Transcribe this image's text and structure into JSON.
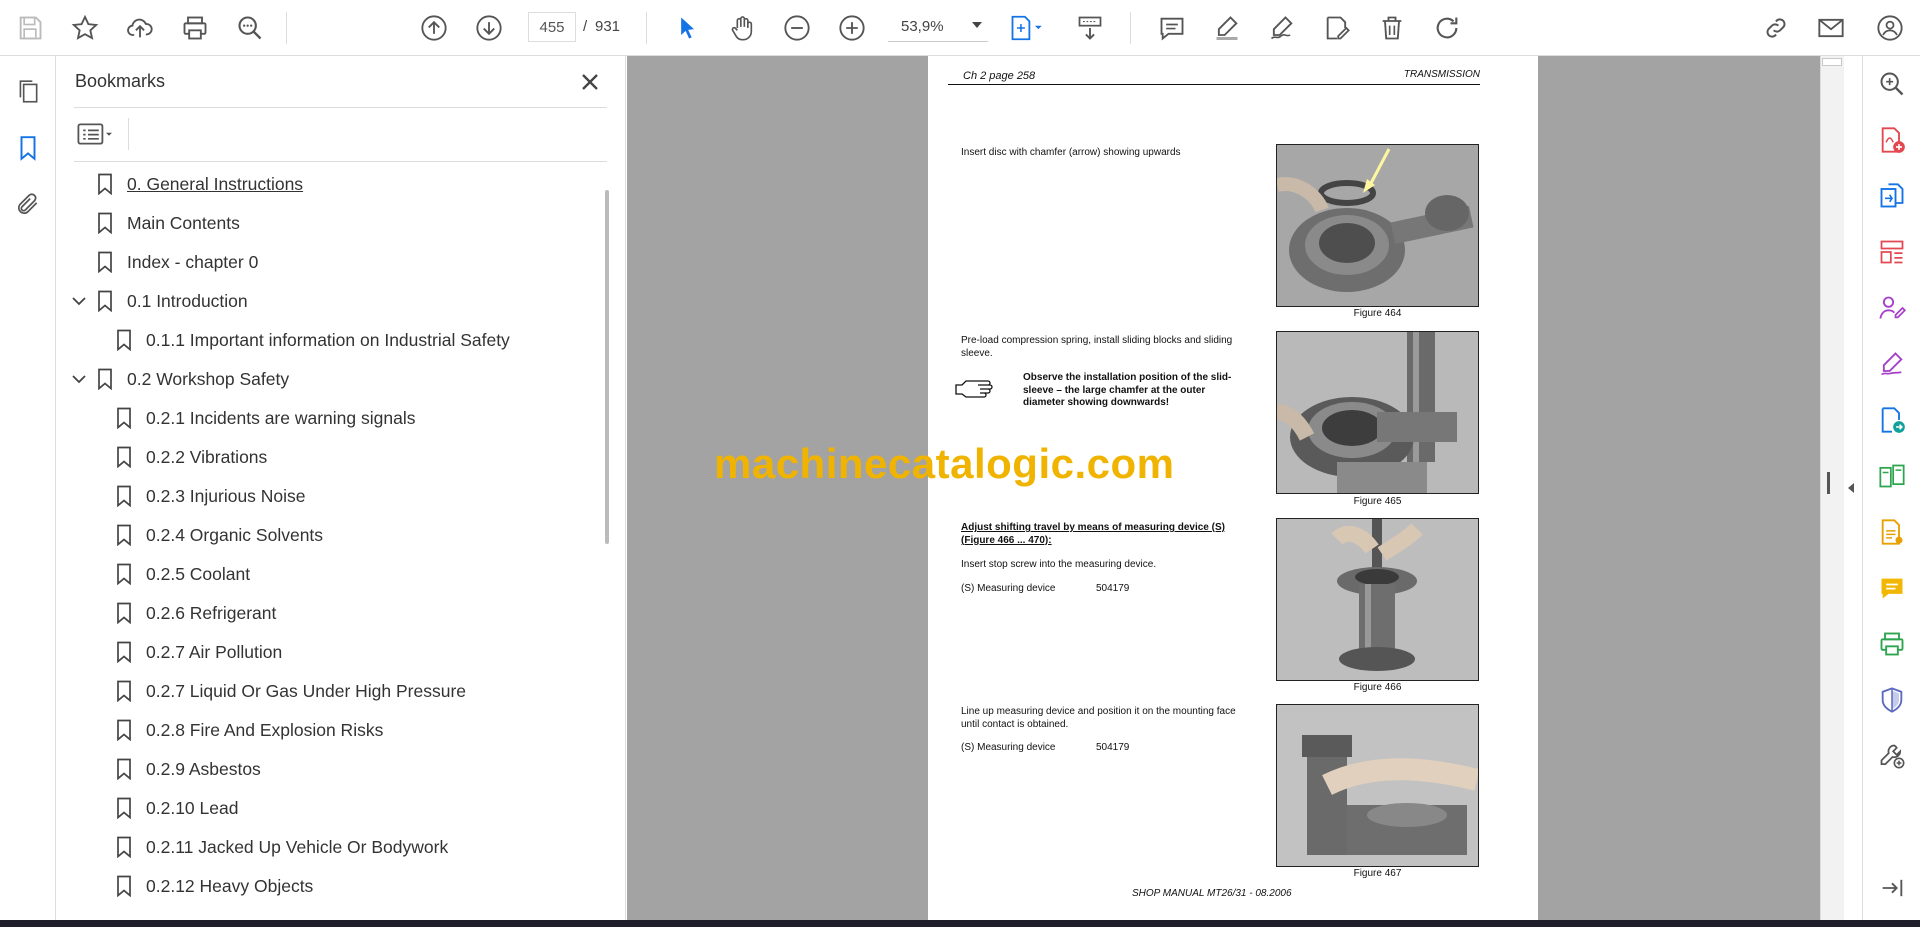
{
  "toolbar": {
    "page_current": "455",
    "page_separator": "/",
    "page_total": "931",
    "zoom": "53,9%"
  },
  "bookmarks_panel": {
    "title": "Bookmarks",
    "items": [
      {
        "label": "0. General Instructions",
        "level": 0,
        "expandable": false
      },
      {
        "label": "Main Contents",
        "level": 0,
        "expandable": false
      },
      {
        "label": "Index - chapter 0",
        "level": 0,
        "expandable": false
      },
      {
        "label": "0.1 Introduction",
        "level": 0,
        "expandable": true
      },
      {
        "label": "0.1.1 Important information on Industrial Safety",
        "level": 1,
        "expandable": false
      },
      {
        "label": "0.2 Workshop Safety",
        "level": 0,
        "expandable": true
      },
      {
        "label": "0.2.1 Incidents are warning signals",
        "level": 1,
        "expandable": false
      },
      {
        "label": "0.2.2  Vibrations",
        "level": 1,
        "expandable": false
      },
      {
        "label": "0.2.3 Injurious Noise",
        "level": 1,
        "expandable": false
      },
      {
        "label": "0.2.4 Organic Solvents",
        "level": 1,
        "expandable": false
      },
      {
        "label": "0.2.5 Coolant",
        "level": 1,
        "expandable": false
      },
      {
        "label": "0.2.6 Refrigerant",
        "level": 1,
        "expandable": false
      },
      {
        "label": "0.2.7 Air Pollution",
        "level": 1,
        "expandable": false
      },
      {
        "label": "0.2.7 Liquid Or Gas Under High Pressure",
        "level": 1,
        "expandable": false
      },
      {
        "label": "0.2.8 Fire And Explosion Risks",
        "level": 1,
        "expandable": false
      },
      {
        "label": "0.2.9 Asbestos",
        "level": 1,
        "expandable": false
      },
      {
        "label": "0.2.10 Lead",
        "level": 1,
        "expandable": false
      },
      {
        "label": "0.2.11 Jacked Up Vehicle Or Bodywork",
        "level": 1,
        "expandable": false
      },
      {
        "label": "0.2.12 Heavy Objects",
        "level": 1,
        "expandable": false
      }
    ]
  },
  "document": {
    "header_left": "Ch 2 page 258",
    "header_right": "TRANSMISSION",
    "step1": "Insert disc with chamfer (arrow) showing upwards",
    "step2": "Pre-load compression spring, install sliding blocks and sliding sleeve.",
    "step2_note": "Observe the installation position of the slid-sleeve – the large chamfer at the outer diameter showing downwards!",
    "step3_heading": "Adjust shifting travel by means of measuring device (S) (Figure 466 ... 470):",
    "step3_text": "Insert stop screw into the measuring device.",
    "step3_tool_name": "(S) Measuring device",
    "step3_tool_no": "504179",
    "step4_text": "Line up measuring device and position it on the mounting face until contact is obtained.",
    "step4_tool_name": "(S) Measuring device",
    "step4_tool_no": "504179",
    "fig1": "Figure 464",
    "fig2": "Figure 465",
    "fig3": "Figure 466",
    "fig4": "Figure 467",
    "footer": "SHOP MANUAL MT26/31 - 08.2006"
  },
  "watermark": "machinecatalogic.com",
  "colors": {
    "accent_blue": "#1473e6",
    "viewer_bg": "#a3a3a3",
    "watermark": "#f0b400"
  }
}
